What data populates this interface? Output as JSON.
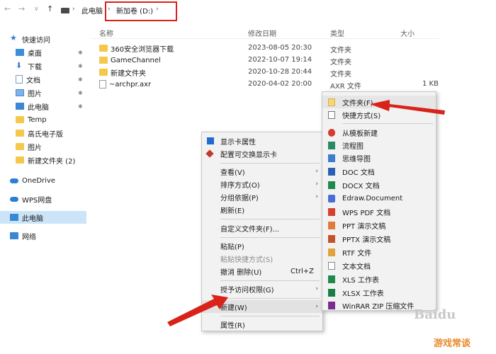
{
  "address": {
    "thispc": "此电脑",
    "drive": "新加卷 (D:)",
    "sep": "›"
  },
  "nav": {
    "back": "←",
    "forward": "→",
    "dropdown": "∨",
    "up": "↑"
  },
  "sidebar": {
    "items": [
      {
        "label": "快速访问"
      },
      {
        "label": "桌面"
      },
      {
        "label": "下载"
      },
      {
        "label": "文档"
      },
      {
        "label": "图片"
      },
      {
        "label": "此电脑"
      },
      {
        "label": "Temp"
      },
      {
        "label": "高氏电子版"
      },
      {
        "label": "图片"
      },
      {
        "label": "新建文件夹 (2)"
      },
      {
        "label": "OneDrive"
      },
      {
        "label": "WPS网盘"
      },
      {
        "label": "此电脑"
      },
      {
        "label": "网络"
      }
    ]
  },
  "columns": {
    "name": "名称",
    "modified": "修改日期",
    "type": "类型",
    "size": "大小"
  },
  "files": [
    {
      "name": "360安全浏览器下载",
      "modified": "2023-08-05 20:30",
      "type": "文件夹",
      "size": ""
    },
    {
      "name": "GameChannel",
      "modified": "2022-10-07 19:14",
      "type": "文件夹",
      "size": ""
    },
    {
      "name": "新建文件夹",
      "modified": "2020-10-28 20:44",
      "type": "文件夹",
      "size": ""
    },
    {
      "name": "~archpr.axr",
      "modified": "2020-04-02 20:00",
      "type": "AXR 文件",
      "size": "1 KB"
    }
  ],
  "context_menu": {
    "items": [
      {
        "label": "显示卡属性"
      },
      {
        "label": "配置可交换显示卡"
      },
      {
        "label": "查看(V)"
      },
      {
        "label": "排序方式(O)"
      },
      {
        "label": "分组依据(P)"
      },
      {
        "label": "刷新(E)"
      },
      {
        "label": "自定义文件夹(F)..."
      },
      {
        "label": "粘贴(P)"
      },
      {
        "label": "粘贴快捷方式(S)"
      },
      {
        "label": "撤消 删除(U)",
        "shortcut": "Ctrl+Z"
      },
      {
        "label": "授予访问权限(G)"
      },
      {
        "label": "新建(W)"
      },
      {
        "label": "属性(R)"
      }
    ],
    "submenu_arrow": "›"
  },
  "submenu": {
    "items": [
      {
        "label": "文件夹(F)"
      },
      {
        "label": "快捷方式(S)"
      },
      {
        "label": "从模板新建"
      },
      {
        "label": "流程图"
      },
      {
        "label": "思维导图"
      },
      {
        "label": "DOC 文档"
      },
      {
        "label": "DOCX 文档"
      },
      {
        "label": "Edraw.Document"
      },
      {
        "label": "WPS PDF 文档"
      },
      {
        "label": "PPT 演示文稿"
      },
      {
        "label": "PPTX 演示文稿"
      },
      {
        "label": "RTF 文件"
      },
      {
        "label": "文本文档"
      },
      {
        "label": "XLS 工作表"
      },
      {
        "label": "XLSX 工作表"
      },
      {
        "label": "WinRAR ZIP 压缩文件"
      }
    ]
  },
  "watermark": {
    "logo": "Baidu",
    "text": "游戏常谈"
  },
  "colors": {
    "highlight_border": "#d9221a",
    "selection": "#cce4f7",
    "arrow": "#d9221a"
  }
}
